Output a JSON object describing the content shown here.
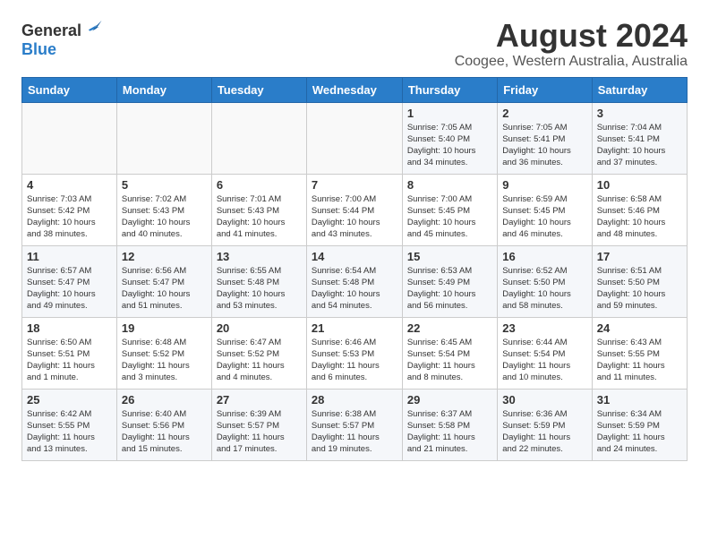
{
  "logo": {
    "general": "General",
    "blue": "Blue"
  },
  "title": "August 2024",
  "subtitle": "Coogee, Western Australia, Australia",
  "days_of_week": [
    "Sunday",
    "Monday",
    "Tuesday",
    "Wednesday",
    "Thursday",
    "Friday",
    "Saturday"
  ],
  "weeks": [
    [
      {
        "day": "",
        "detail": ""
      },
      {
        "day": "",
        "detail": ""
      },
      {
        "day": "",
        "detail": ""
      },
      {
        "day": "",
        "detail": ""
      },
      {
        "day": "1",
        "detail": "Sunrise: 7:05 AM\nSunset: 5:40 PM\nDaylight: 10 hours\nand 34 minutes."
      },
      {
        "day": "2",
        "detail": "Sunrise: 7:05 AM\nSunset: 5:41 PM\nDaylight: 10 hours\nand 36 minutes."
      },
      {
        "day": "3",
        "detail": "Sunrise: 7:04 AM\nSunset: 5:41 PM\nDaylight: 10 hours\nand 37 minutes."
      }
    ],
    [
      {
        "day": "4",
        "detail": "Sunrise: 7:03 AM\nSunset: 5:42 PM\nDaylight: 10 hours\nand 38 minutes."
      },
      {
        "day": "5",
        "detail": "Sunrise: 7:02 AM\nSunset: 5:43 PM\nDaylight: 10 hours\nand 40 minutes."
      },
      {
        "day": "6",
        "detail": "Sunrise: 7:01 AM\nSunset: 5:43 PM\nDaylight: 10 hours\nand 41 minutes."
      },
      {
        "day": "7",
        "detail": "Sunrise: 7:00 AM\nSunset: 5:44 PM\nDaylight: 10 hours\nand 43 minutes."
      },
      {
        "day": "8",
        "detail": "Sunrise: 7:00 AM\nSunset: 5:45 PM\nDaylight: 10 hours\nand 45 minutes."
      },
      {
        "day": "9",
        "detail": "Sunrise: 6:59 AM\nSunset: 5:45 PM\nDaylight: 10 hours\nand 46 minutes."
      },
      {
        "day": "10",
        "detail": "Sunrise: 6:58 AM\nSunset: 5:46 PM\nDaylight: 10 hours\nand 48 minutes."
      }
    ],
    [
      {
        "day": "11",
        "detail": "Sunrise: 6:57 AM\nSunset: 5:47 PM\nDaylight: 10 hours\nand 49 minutes."
      },
      {
        "day": "12",
        "detail": "Sunrise: 6:56 AM\nSunset: 5:47 PM\nDaylight: 10 hours\nand 51 minutes."
      },
      {
        "day": "13",
        "detail": "Sunrise: 6:55 AM\nSunset: 5:48 PM\nDaylight: 10 hours\nand 53 minutes."
      },
      {
        "day": "14",
        "detail": "Sunrise: 6:54 AM\nSunset: 5:48 PM\nDaylight: 10 hours\nand 54 minutes."
      },
      {
        "day": "15",
        "detail": "Sunrise: 6:53 AM\nSunset: 5:49 PM\nDaylight: 10 hours\nand 56 minutes."
      },
      {
        "day": "16",
        "detail": "Sunrise: 6:52 AM\nSunset: 5:50 PM\nDaylight: 10 hours\nand 58 minutes."
      },
      {
        "day": "17",
        "detail": "Sunrise: 6:51 AM\nSunset: 5:50 PM\nDaylight: 10 hours\nand 59 minutes."
      }
    ],
    [
      {
        "day": "18",
        "detail": "Sunrise: 6:50 AM\nSunset: 5:51 PM\nDaylight: 11 hours\nand 1 minute."
      },
      {
        "day": "19",
        "detail": "Sunrise: 6:48 AM\nSunset: 5:52 PM\nDaylight: 11 hours\nand 3 minutes."
      },
      {
        "day": "20",
        "detail": "Sunrise: 6:47 AM\nSunset: 5:52 PM\nDaylight: 11 hours\nand 4 minutes."
      },
      {
        "day": "21",
        "detail": "Sunrise: 6:46 AM\nSunset: 5:53 PM\nDaylight: 11 hours\nand 6 minutes."
      },
      {
        "day": "22",
        "detail": "Sunrise: 6:45 AM\nSunset: 5:54 PM\nDaylight: 11 hours\nand 8 minutes."
      },
      {
        "day": "23",
        "detail": "Sunrise: 6:44 AM\nSunset: 5:54 PM\nDaylight: 11 hours\nand 10 minutes."
      },
      {
        "day": "24",
        "detail": "Sunrise: 6:43 AM\nSunset: 5:55 PM\nDaylight: 11 hours\nand 11 minutes."
      }
    ],
    [
      {
        "day": "25",
        "detail": "Sunrise: 6:42 AM\nSunset: 5:55 PM\nDaylight: 11 hours\nand 13 minutes."
      },
      {
        "day": "26",
        "detail": "Sunrise: 6:40 AM\nSunset: 5:56 PM\nDaylight: 11 hours\nand 15 minutes."
      },
      {
        "day": "27",
        "detail": "Sunrise: 6:39 AM\nSunset: 5:57 PM\nDaylight: 11 hours\nand 17 minutes."
      },
      {
        "day": "28",
        "detail": "Sunrise: 6:38 AM\nSunset: 5:57 PM\nDaylight: 11 hours\nand 19 minutes."
      },
      {
        "day": "29",
        "detail": "Sunrise: 6:37 AM\nSunset: 5:58 PM\nDaylight: 11 hours\nand 21 minutes."
      },
      {
        "day": "30",
        "detail": "Sunrise: 6:36 AM\nSunset: 5:59 PM\nDaylight: 11 hours\nand 22 minutes."
      },
      {
        "day": "31",
        "detail": "Sunrise: 6:34 AM\nSunset: 5:59 PM\nDaylight: 11 hours\nand 24 minutes."
      }
    ]
  ]
}
